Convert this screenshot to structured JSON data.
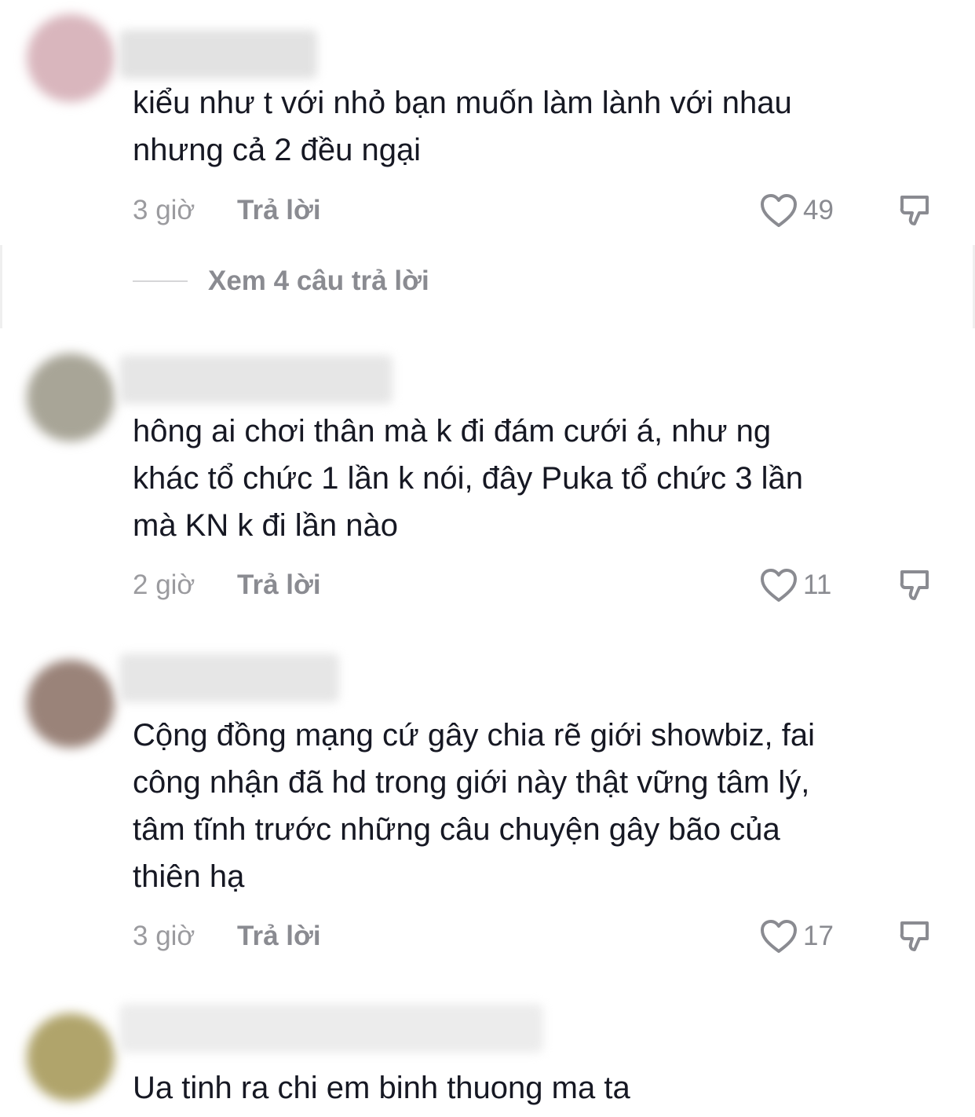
{
  "comments": [
    {
      "text": "kiểu như t với nhỏ bạn muốn làm lành với nhau\nnhưng cả 2 đều ngại",
      "time": "3 giờ",
      "reply_label": "Trả lời",
      "likes": "49",
      "avatar_color": "#d9b6bd"
    },
    {
      "text": "hông ai chơi thân mà k đi đám cưới á, như ng\nkhác tổ chức 1 lần k nói, đây Puka tổ chức 3 lần\nmà KN k đi lần nào",
      "time": "2 giờ",
      "reply_label": "Trả lời",
      "likes": "11",
      "avatar_color": "#a8a597"
    },
    {
      "text": "Cộng đồng mạng cứ gây chia rẽ giới showbiz, fai\ncông nhận đã hd trong giới này thật vững tâm lý,\ntâm tĩnh trước những câu chuyện gây bão của\nthiên hạ",
      "time": "3 giờ",
      "reply_label": "Trả lời",
      "likes": "17",
      "avatar_color": "#9a8379"
    },
    {
      "text": "Ua tinh ra chi em binh thuong ma ta",
      "avatar_color": "#b0a46b"
    }
  ],
  "view_replies": "Xem 4 câu trả lời",
  "colors": {
    "text": "#161823",
    "muted": "#8a8b91"
  }
}
